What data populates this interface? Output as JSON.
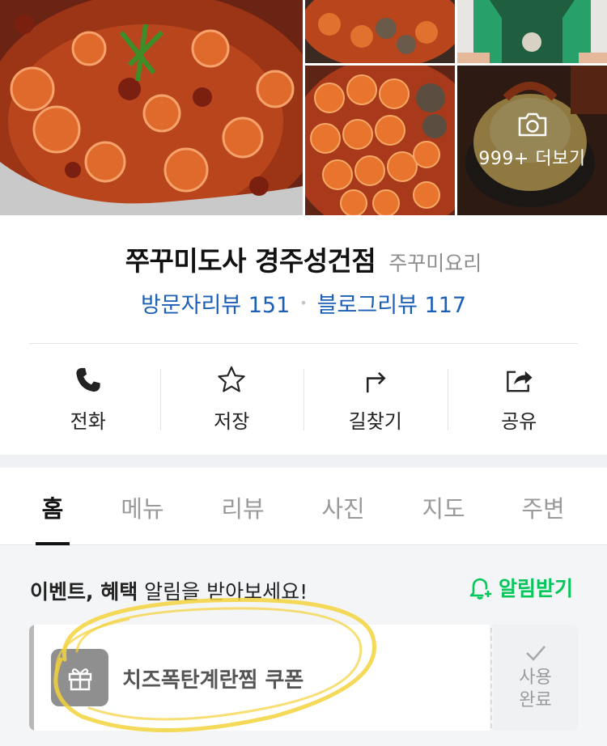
{
  "gallery": {
    "more_label": "999+ 더보기",
    "camera_icon": "camera-icon"
  },
  "place": {
    "name": "쭈꾸미도사 경주성건점",
    "category": "주꾸미요리",
    "visitor_review_label": "방문자리뷰",
    "visitor_review_count": "151",
    "separator": "•",
    "blog_review_label": "블로그리뷰",
    "blog_review_count": "117"
  },
  "actions": [
    {
      "label": "전화",
      "icon": "phone-icon"
    },
    {
      "label": "저장",
      "icon": "star-icon"
    },
    {
      "label": "길찾기",
      "icon": "directions-icon"
    },
    {
      "label": "공유",
      "icon": "share-icon"
    }
  ],
  "tabs": [
    "홈",
    "메뉴",
    "리뷰",
    "사진",
    "지도",
    "주변"
  ],
  "active_tab": "홈",
  "notice": {
    "title_bold": "이벤트, 혜택",
    "title_rest": " 알림을 받아보세요!",
    "button_label": "알림받기"
  },
  "coupon": {
    "name": "치즈폭탄계란찜 쿠폰",
    "status_line1": "사용",
    "status_line2": "완료"
  },
  "colors": {
    "link_blue": "#1b5fb6",
    "accent_green": "#03c75a",
    "highlight_yellow": "#f3d23b"
  }
}
